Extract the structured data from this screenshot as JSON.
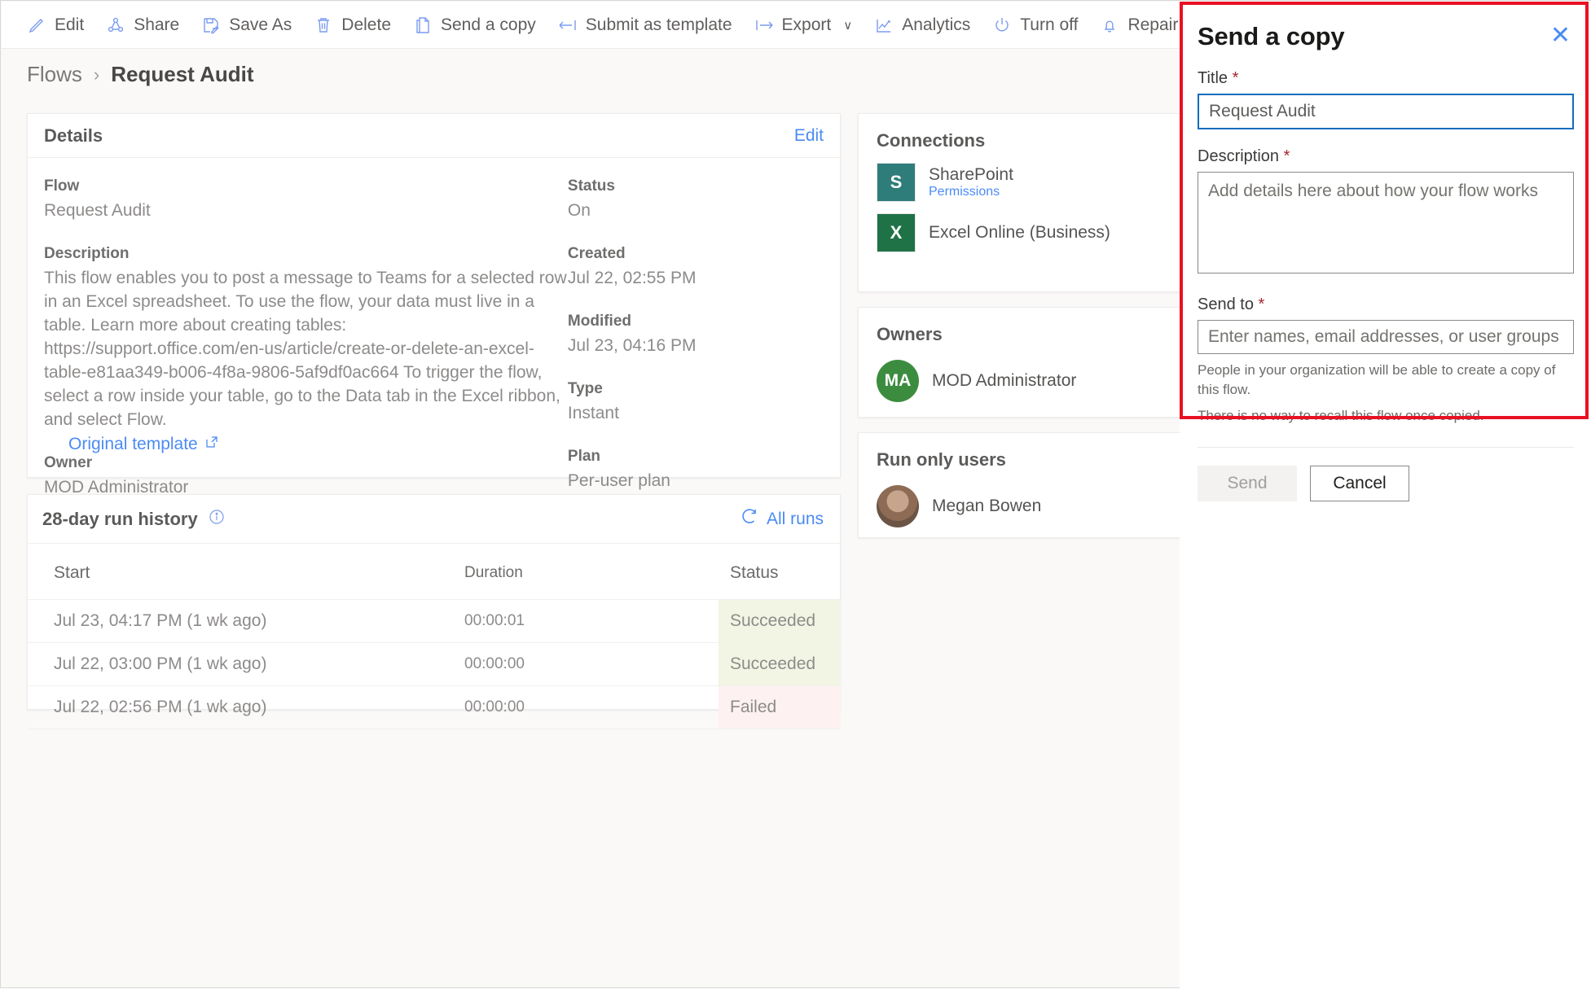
{
  "toolbar": {
    "items": [
      {
        "label": "Edit",
        "icon": "pencil-icon"
      },
      {
        "label": "Share",
        "icon": "share-icon"
      },
      {
        "label": "Save As",
        "icon": "save-as-icon"
      },
      {
        "label": "Delete",
        "icon": "trash-icon"
      },
      {
        "label": "Send a copy",
        "icon": "copy-icon"
      },
      {
        "label": "Submit as template",
        "icon": "arrow-left-bar-icon"
      },
      {
        "label": "Export",
        "icon": "arrow-right-bar-icon",
        "chevron": "∨"
      },
      {
        "label": "Analytics",
        "icon": "analytics-icon"
      },
      {
        "label": "Turn off",
        "icon": "power-icon"
      },
      {
        "label": "Repair tips",
        "icon": "bell-icon"
      }
    ]
  },
  "breadcrumb": {
    "parent": "Flows",
    "separator": "›",
    "current": "Request Audit"
  },
  "details": {
    "title": "Details",
    "edit_label": "Edit",
    "left_fields": [
      {
        "label": "Flow",
        "value": "Request Audit"
      },
      {
        "label": "Description",
        "value": "This flow enables you to post a message to Teams for a selected row in an Excel spreadsheet. To use the flow, your data must live in a table. Learn more about creating tables: https://support.office.com/en-us/article/create-or-delete-an-excel-table-e81aa349-b006-4f8a-9806-5af9df0ac664 To trigger the flow, select a row inside your table, go to the Data tab in the Excel ribbon, and select Flow."
      },
      {
        "label": "Owner",
        "value": "MOD Administrator"
      }
    ],
    "right_fields": [
      {
        "label": "Status",
        "value": "On"
      },
      {
        "label": "Created",
        "value": "Jul 22, 02:55 PM"
      },
      {
        "label": "Modified",
        "value": "Jul 23, 04:16 PM"
      },
      {
        "label": "Type",
        "value": "Instant"
      },
      {
        "label": "Plan",
        "value": "Per-user plan"
      }
    ],
    "original_template_label": "Original template"
  },
  "run_history": {
    "title": "28-day run history",
    "info_icon": "info-icon",
    "all_runs_label": "All runs",
    "refresh_icon": "refresh-icon",
    "columns": [
      "Start",
      "Duration",
      "Status"
    ],
    "rows": [
      {
        "start": "Jul 23, 04:17 PM (1 wk ago)",
        "duration": "00:00:01",
        "status": "Succeeded"
      },
      {
        "start": "Jul 22, 03:00 PM (1 wk ago)",
        "duration": "00:00:00",
        "status": "Succeeded"
      },
      {
        "start": "Jul 22, 02:56 PM (1 wk ago)",
        "duration": "00:00:00",
        "status": "Failed"
      }
    ],
    "status_colors": {
      "succeeded_bg": "#f2f5e3",
      "failed_bg": "#fdf1f1"
    }
  },
  "right_rail": {
    "connections": {
      "title": "Connections",
      "items": [
        {
          "name": "SharePoint",
          "sub": "Permissions",
          "badge": "S"
        },
        {
          "name": "Excel Online (Business)",
          "sub": "",
          "badge": "X"
        }
      ]
    },
    "owners": {
      "title": "Owners",
      "items": [
        {
          "initials": "MA",
          "name": "MOD Administrator"
        }
      ]
    },
    "run_only_users": {
      "title": "Run only users",
      "items": [
        {
          "name": "Megan Bowen"
        }
      ]
    }
  },
  "panel": {
    "title": "Send a copy",
    "close_icon": "close-icon",
    "title_field": {
      "label": "Title",
      "required": "*",
      "value": "Request Audit"
    },
    "description_field": {
      "label": "Description",
      "required": "*",
      "value": "",
      "placeholder": "Add details here about how your flow works"
    },
    "send_to_field": {
      "label": "Send to",
      "required": "*",
      "value": "",
      "placeholder": "Enter names, email addresses, or user groups"
    },
    "hints": [
      "People in your organization will be able to create a copy of this flow.",
      "There is no way to recall this flow once copied."
    ],
    "send_label": "Send",
    "cancel_label": "Cancel",
    "highlight_color": "#e81123"
  }
}
